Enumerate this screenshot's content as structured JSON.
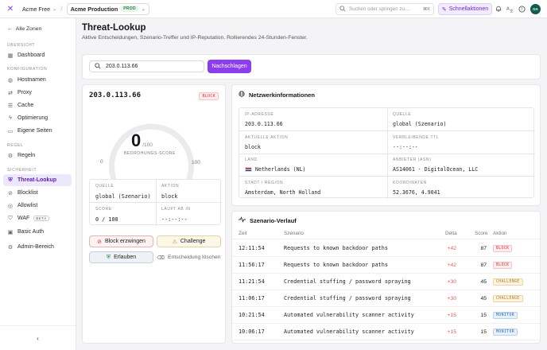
{
  "topbar": {
    "workspace": "Acme Free",
    "zone": "Acme Production",
    "zone_badge": "PROD",
    "search_placeholder": "Suchen oder springen zu…",
    "search_shortcut": "⌘K",
    "quick_actions": "Schnellaktionen",
    "avatar_initials": "GA"
  },
  "sidebar": {
    "back": "Alle Zonen",
    "sections": {
      "overview": "ÜBERSICHT",
      "config": "KONFIGURATION",
      "rule": "REGEL",
      "security": "SICHERHEIT"
    },
    "items": {
      "dashboard": "Dashboard",
      "hostnames": "Hostnamen",
      "proxy": "Proxy",
      "cache": "Cache",
      "optimization": "Optimierung",
      "pages": "Eigene Seiten",
      "rules": "Regeln",
      "threat": "Threat-Lookup",
      "blocklist": "Blocklist",
      "allowlist": "Allowlist",
      "waf": "WAF",
      "waf_badge": "BETA",
      "basic_auth": "Basic Auth",
      "admin_area": "Admin-Bereich"
    }
  },
  "page": {
    "title": "Threat-Lookup",
    "subtitle": "Aktive Entscheidungen, Szenario-Treffer und IP-Reputation. Rollierendes 24-Stunden-Fenster."
  },
  "search": {
    "value": "203.0.113.66",
    "button": "Nachschlagen"
  },
  "ip_card": {
    "ip": "203.0.113.66",
    "status_badge": "BLOCK",
    "score": "0",
    "score_max": "/100",
    "score_value": 0,
    "gauge_label": "BEDROHUNGS-SCORE",
    "gauge_min": "0",
    "gauge_max": "100",
    "source_label": "QUELLE",
    "source_value": "global (Szenario)",
    "action_label": "AKTION",
    "action_value": "block",
    "score_label": "SCORE",
    "score_text": "0 / 100",
    "expires_label": "LÄUFT AB IN",
    "expires_value": "--:--:--",
    "btn_block": "Block erzwingen",
    "btn_challenge": "Challenge",
    "btn_allow": "Erlauben",
    "btn_clear": "Entscheidung löschen"
  },
  "network": {
    "title": "Netzwerkinformationen",
    "cells": [
      {
        "label": "IP-ADRESSE",
        "value": "203.0.113.66"
      },
      {
        "label": "QUELLE",
        "value": "global (Szenario)"
      },
      {
        "label": "AKTUELLE AKTION",
        "value": "block"
      },
      {
        "label": "VERBLEIBENDE TTL",
        "value": "--:--:--"
      },
      {
        "label": "LAND",
        "value": "Netherlands (NL)"
      },
      {
        "label": "ANBIETER (ASN)",
        "value": "AS14061 · DigitalOcean, LLC"
      },
      {
        "label": "STADT / REGION",
        "value": "Amsterdam, North Holland"
      },
      {
        "label": "KOORDINATEN",
        "value": "52.3676, 4.9041"
      }
    ]
  },
  "history": {
    "title": "Szenario-Verlauf",
    "columns": {
      "time": "Zeit",
      "scenario": "Szenario",
      "delta": "Delta",
      "score": "Score",
      "action": "Aktion"
    },
    "rows": [
      {
        "time": "12:11:54",
        "scenario": "Requests to known backdoor paths",
        "delta": "+42",
        "score": "87",
        "action": "BLOCK"
      },
      {
        "time": "11:56:17",
        "scenario": "Requests to known backdoor paths",
        "delta": "+42",
        "score": "87",
        "action": "BLOCK"
      },
      {
        "time": "11:21:54",
        "scenario": "Credential stuffing / password spraying",
        "delta": "+30",
        "score": "45",
        "action": "CHALLENGE"
      },
      {
        "time": "11:06:17",
        "scenario": "Credential stuffing / password spraying",
        "delta": "+30",
        "score": "45",
        "action": "CHALLENGE"
      },
      {
        "time": "10:21:54",
        "scenario": "Automated vulnerability scanner activity",
        "delta": "+15",
        "score": "15",
        "action": "MONITOR"
      },
      {
        "time": "10:06:17",
        "scenario": "Automated vulnerability scanner activity",
        "delta": "+15",
        "score": "15",
        "action": "MONITOR"
      }
    ]
  }
}
